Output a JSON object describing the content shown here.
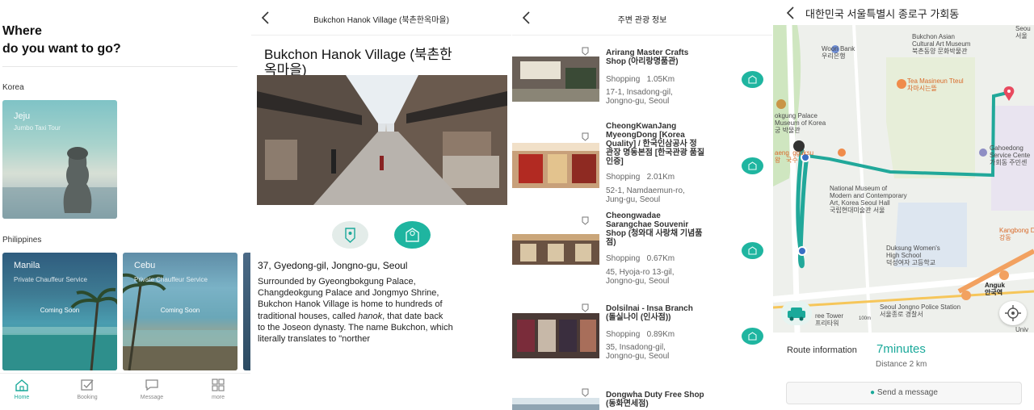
{
  "screen1": {
    "heading_line1": "Where",
    "heading_line2": "do you want to go?",
    "sections": [
      {
        "label": "Korea"
      },
      {
        "label": "Philippines"
      }
    ],
    "cards": [
      {
        "title": "Jeju",
        "subtitle": "Jumbo Taxi Tour",
        "status": ""
      },
      {
        "title": "Manila",
        "subtitle": "Private Chauffeur Service",
        "status": "Coming Soon"
      },
      {
        "title": "Cebu",
        "subtitle": "Private Chauffeur Service",
        "status": "Coming Soon"
      }
    ],
    "tabs": [
      {
        "label": "Home",
        "icon": "home-icon",
        "active": true
      },
      {
        "label": "Booking",
        "icon": "booking-icon",
        "active": false
      },
      {
        "label": "Message",
        "icon": "message-icon",
        "active": false
      },
      {
        "label": "more",
        "icon": "grid-icon",
        "active": false
      }
    ]
  },
  "screen2": {
    "header_title": "Bukchon Hanok Village (북촌한옥마을)",
    "name_line1": "Bukchon Hanok Village (북촌한",
    "name_line2": "옥마을)",
    "address": "37, Gyedong-gil, Jongno-gu, Seoul",
    "description_lines": [
      "Surrounded by Gyeongbokgung Palace,",
      "Changdeokgung Palace and Jongmyo Shrine,",
      "Bukchon Hanok Village is home to hundreds of",
      "traditional houses, called ",
      "hanok",
      ", that date back",
      "to the Joseon dynasty. The name Bukchon, which",
      "literally translates to \"norther"
    ]
  },
  "screen3": {
    "header_title": "주변 관광 정보",
    "places": [
      {
        "name_lines": [
          "Arirang Master Crafts",
          "Shop (아리랑명품관)"
        ],
        "category": "Shopping",
        "distance": "1.05Km",
        "address_lines": [
          "17-1, Insadong-gil,",
          "Jongno-gu, Seoul"
        ]
      },
      {
        "name_lines": [
          "CheongKwanJang",
          "MyeongDong [Korea",
          "Quality] / 한국인삼공사 정",
          "관장 명동본점 [한국관광 품질",
          "인증]"
        ],
        "category": "Shopping",
        "distance": "2.01Km",
        "address_lines": [
          "52-1, Namdaemun-ro,",
          "Jung-gu, Seoul"
        ]
      },
      {
        "name_lines": [
          "Cheongwadae",
          "Sarangchae Souvenir",
          "Shop (청와대 사랑채 기념품",
          "점)"
        ],
        "category": "Shopping",
        "distance": "0.67Km",
        "address_lines": [
          "45, Hyoja-ro 13-gil,",
          "Jongno-gu, Seoul"
        ]
      },
      {
        "name_lines": [
          "Dolsilnai - Insa Branch",
          "(돌실나이 (인사점))"
        ],
        "category": "Shopping",
        "distance": "0.89Km",
        "address_lines": [
          "35, Insadong-gil,",
          "Jongno-gu, Seoul"
        ]
      },
      {
        "name_lines": [
          "Dongwha Duty Free Shop",
          "(동화면세점)"
        ],
        "category": "",
        "distance": "",
        "address_lines": []
      }
    ]
  },
  "screen4": {
    "header_title": "대한민국 서울특별시 종로구 가회동",
    "map_labels": {
      "woori": "Woori Bank\n우리은행",
      "asian": "Bukchon Asian\nCultural Art Museum\n북촌동양 문화박물관",
      "tea": "Tea Masineun Tteul\n차마시는뜰",
      "palace": "okgung Palace\nMuseum of Korea\n궁 박물관",
      "gukbap": "aeng  gguksu\n왕   국수",
      "gahoe": "Gahoedong\nService Cente\n가회동 주민센",
      "mmca": "National Museum of\nModern and Contemporary\nArt, Korea Seoul Hall\n국립현대미술관 서울",
      "duksung": "Duksung Women's\nHigh School\n덕성여자 고등학교",
      "kangbuk": "Kangbong Do\n강동",
      "police": "Seoul Jongno Police Station\n서울종로 경찰서",
      "anguk": "Anguk\n안국역",
      "free": "ree Tower\n프리타워",
      "scale": "100m",
      "seoul": "Seou\n서울",
      "univ": "Univ"
    },
    "route_label": "Route information",
    "route_time": "7minutes",
    "route_distance": "Distance 2 km",
    "message_button": "Send a message"
  },
  "colors": {
    "accent": "#1fb5a0",
    "route": "#21a89a",
    "marker": "#e84a5f"
  }
}
